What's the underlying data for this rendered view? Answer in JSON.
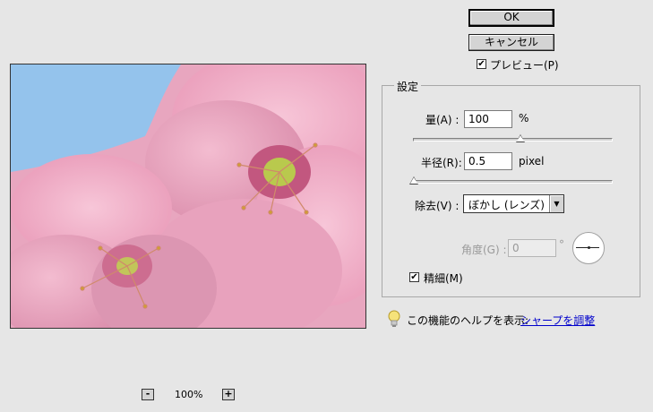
{
  "buttons": {
    "ok": "OK",
    "cancel": "キャンセル"
  },
  "preview_toggle": {
    "label": "プレビュー(P)",
    "checked": true,
    "check_glyph": "✔"
  },
  "settings": {
    "group_label": "設定",
    "amount": {
      "label": "量(A) :",
      "value": "100",
      "unit": "%",
      "slider_fraction": 0.54
    },
    "radius": {
      "label": "半径(R):",
      "value": "0.5",
      "unit": "pixel",
      "slider_fraction": 0.0
    },
    "remove": {
      "label": "除去(V) :",
      "selected": "ぼかし (レンズ)"
    },
    "angle": {
      "label": "角度(G) :",
      "value": "0",
      "unit": "°",
      "disabled": true
    },
    "more_accurate": {
      "label": "精細(M)",
      "checked": true,
      "check_glyph": "✔"
    }
  },
  "help": {
    "text": "この機能のヘルプを表示:",
    "link": "シャープを調整"
  },
  "zoom": {
    "minus": "-",
    "level": "100%",
    "plus": "+"
  },
  "icons": {
    "help": "lightbulb-icon",
    "select_arrow": "▼"
  }
}
